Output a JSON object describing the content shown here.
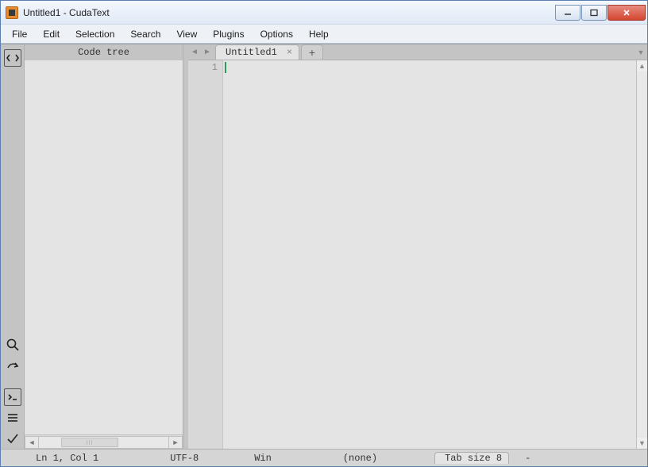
{
  "window": {
    "title": "Untitled1 - CudaText"
  },
  "menu": {
    "items": [
      "File",
      "Edit",
      "Selection",
      "Search",
      "View",
      "Plugins",
      "Options",
      "Help"
    ]
  },
  "sidepanel": {
    "title": "Code tree"
  },
  "tabs": {
    "active": {
      "label": "Untitled1"
    }
  },
  "editor": {
    "line_number": "1"
  },
  "status": {
    "position": "Ln 1, Col 1",
    "encoding": "UTF-8",
    "eol": "Win",
    "lexer": "(none)",
    "tabsize": "Tab size 8",
    "trailing": "-"
  }
}
